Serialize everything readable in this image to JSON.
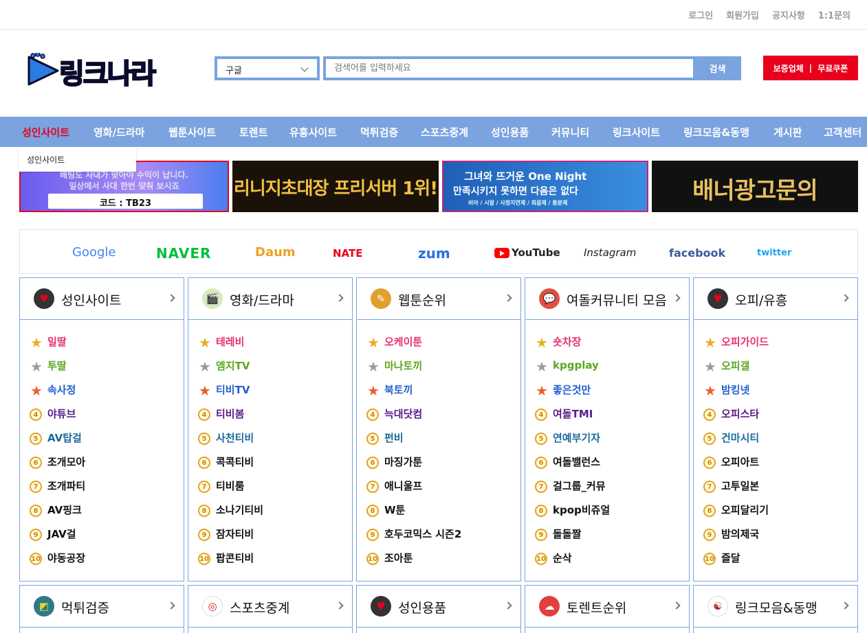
{
  "topbar": {
    "links": [
      "로그인",
      "회원가입",
      "공지사항",
      "1:1문의"
    ]
  },
  "logo": {
    "text": "링크나라"
  },
  "search": {
    "engine": "구글",
    "placeholder": "검색어를 입력하세요",
    "button": "검색"
  },
  "promo": {
    "left": "보증업체",
    "sep": "|",
    "right": "무료쿠폰"
  },
  "nav": {
    "items": [
      "성인사이트",
      "영화/드라마",
      "웹툰사이트",
      "토렌트",
      "유흥사이트",
      "먹튀검증",
      "스포츠중계",
      "성인용품",
      "커뮤니티",
      "링크사이트",
      "링크모음&동맹",
      "게시판",
      "고객센터"
    ]
  },
  "dropdown": {
    "label": "성인사이트"
  },
  "banners": [
    {
      "line1": "배팅도 사내가 맞아야 수익이 납니다.",
      "line2": "일상에서 사대 한번 맞춰 보시죠",
      "code": "코드 : TB23"
    },
    {
      "line1": "리니지초대장 프리서버 1위!"
    },
    {
      "line1": "그녀와 뜨거운 One Night",
      "line2": "만족시키지 못하면 다음은 없다",
      "line3": "비아 / 시알 / 사정지연제 / 최음제 / 흥분제"
    },
    {
      "line1": "배너광고문의"
    }
  ],
  "engines": [
    "Google",
    "NAVER",
    "Daum",
    "NATE",
    "zum",
    "YouTube",
    "Instagram",
    "facebook",
    "twitter"
  ],
  "colors": {
    "accent": "#7aa3df",
    "red": "#e8001c"
  },
  "panels": [
    {
      "title": "성인사이트",
      "icon": "heart-icon",
      "items": [
        "일딸",
        "투딸",
        "속사정",
        "야튜브",
        "AV탑걸",
        "조개모아",
        "조개파티",
        "AV핑크",
        "JAV걸",
        "야동공장"
      ]
    },
    {
      "title": "영화/드라마",
      "icon": "clapperboard-icon",
      "items": [
        "테레비",
        "엠지TV",
        "티비TV",
        "티비봄",
        "사천티비",
        "콕콕티비",
        "티비룸",
        "소나기티비",
        "잠자티비",
        "팝콘티비"
      ]
    },
    {
      "title": "웹툰순위",
      "icon": "pencil-icon",
      "items": [
        "오케이툰",
        "마나토끼",
        "북토끼",
        "늑대닷컴",
        "펀비",
        "마징가툰",
        "애니울프",
        "W툰",
        "호두코믹스 시즌2",
        "조아툰"
      ]
    },
    {
      "title": "여돌커뮤니티 모음",
      "icon": "chat-icon",
      "items": [
        "숏차장",
        "kpgplay",
        "좋은것만",
        "여돌TMI",
        "연예부기자",
        "여돌밸런스",
        "걸그룹_커뮤",
        "kpop비쥬얼",
        "돌돌짤",
        "순삭"
      ]
    },
    {
      "title": "오피/유흥",
      "icon": "heart-icon",
      "items": [
        "오피가이드",
        "오피갤",
        "밤킹넷",
        "오피스타",
        "건마시티",
        "오피아트",
        "고투일본",
        "오피달리기",
        "밤의제국",
        "즐달"
      ]
    },
    {
      "title": "먹튀검증",
      "icon": "shield-icon",
      "items": []
    },
    {
      "title": "스포츠중계",
      "icon": "target-icon",
      "items": []
    },
    {
      "title": "성인용품",
      "icon": "heart-icon",
      "items": []
    },
    {
      "title": "토렌트순위",
      "icon": "cloud-download-icon",
      "items": []
    },
    {
      "title": "링크모음&동맹",
      "icon": "korea-flag-icon",
      "items": []
    }
  ],
  "ranks": [
    "1",
    "2",
    "3",
    "4",
    "5",
    "6",
    "7",
    "8",
    "9",
    "10"
  ]
}
